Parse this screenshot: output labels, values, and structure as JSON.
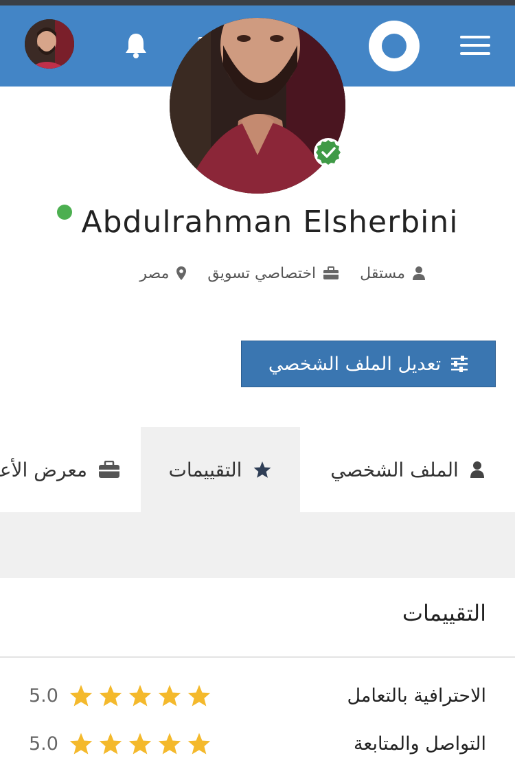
{
  "header": {
    "icons": [
      "user-avatar",
      "bell-icon",
      "envelope-icon",
      "logo",
      "hamburger-menu-icon"
    ]
  },
  "profile": {
    "name": "Abdulrahman Elsherbini",
    "online": true,
    "verified": true,
    "meta": [
      {
        "icon": "user-icon",
        "text": "مستقل"
      },
      {
        "icon": "briefcase-icon",
        "text": "اختصاصي تسويق"
      },
      {
        "icon": "map-marker-icon",
        "text": "مصر"
      }
    ],
    "edit_button": "تعديل الملف الشخصي"
  },
  "tabs": [
    {
      "icon": "user-icon",
      "label": "الملف الشخصي",
      "active": false
    },
    {
      "icon": "star-icon",
      "label": "التقييمات",
      "active": true
    },
    {
      "icon": "briefcase-icon",
      "label": "معرض الأعمال",
      "active": false
    }
  ],
  "ratings": {
    "title": "التقييمات",
    "items": [
      {
        "label": "الاحترافية بالتعامل",
        "stars": 5,
        "score": "5.0"
      },
      {
        "label": "التواصل والمتابعة",
        "stars": 5,
        "score": "5.0"
      }
    ]
  },
  "colors": {
    "navbar": "#4385c6",
    "button": "#3a76b1",
    "star": "#f4b92c",
    "online": "#4caf50",
    "tab_active_bg": "#f0f0f0"
  }
}
